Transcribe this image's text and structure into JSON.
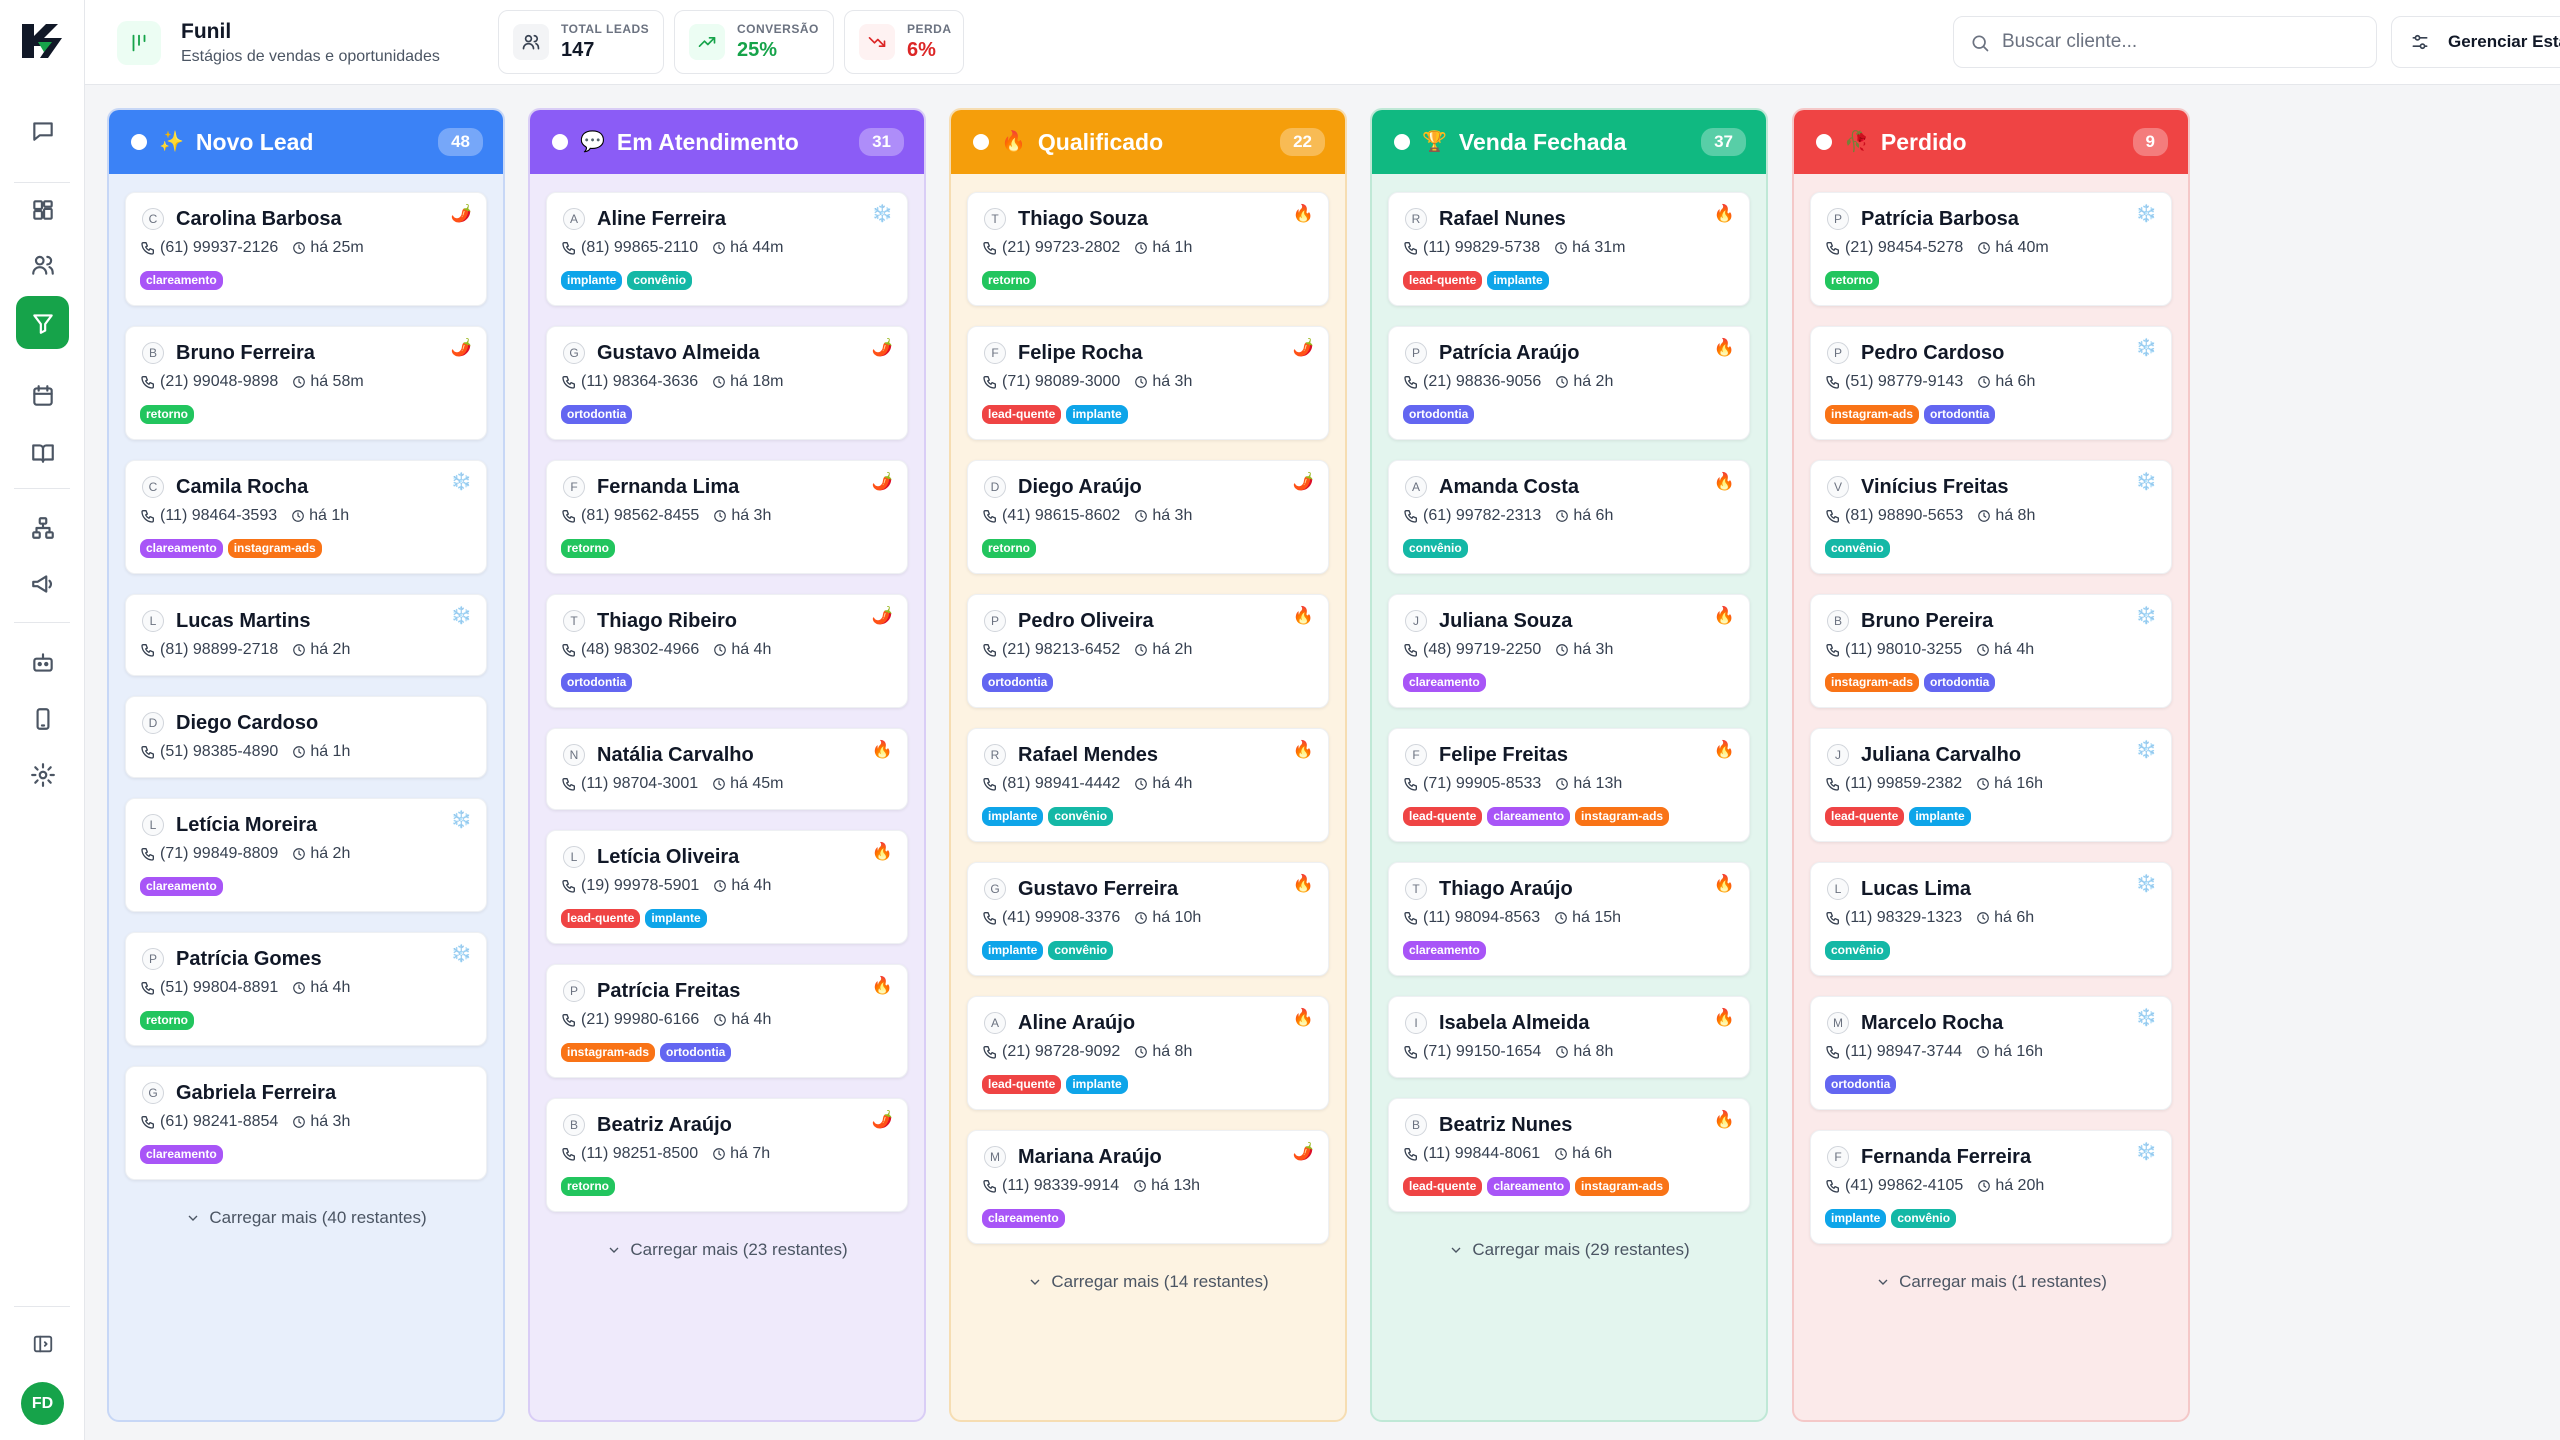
{
  "sidebar": {
    "logo_alt": "logo",
    "items": [
      {
        "icon": "chat-icon",
        "name": "chat"
      },
      {
        "icon": "dashboard-icon",
        "name": "dashboard"
      },
      {
        "icon": "users-icon",
        "name": "contacts"
      },
      {
        "icon": "funnel-icon",
        "name": "funnel",
        "active": true
      },
      {
        "icon": "calendar-icon",
        "name": "calendar"
      },
      {
        "icon": "book-icon",
        "name": "knowledge"
      },
      {
        "icon": "network-icon",
        "name": "integrations"
      },
      {
        "icon": "megaphone-icon",
        "name": "campaigns"
      },
      {
        "icon": "bot-icon",
        "name": "bot"
      },
      {
        "icon": "phone-icon",
        "name": "devices"
      },
      {
        "icon": "gear-icon",
        "name": "settings"
      }
    ],
    "avatar": "FD"
  },
  "header": {
    "title": "Funil",
    "subtitle": "Estágios de vendas e oportunidades",
    "stats": [
      {
        "label": "TOTAL LEADS",
        "value": "147",
        "color": "#111827",
        "icon": "users-icon"
      },
      {
        "label": "CONVERSÃO",
        "value": "25%",
        "color": "#16a34a",
        "icon": "trending-up-icon"
      },
      {
        "label": "PERDA",
        "value": "6%",
        "color": "#dc2626",
        "icon": "trending-down-icon"
      }
    ],
    "search_placeholder": "Buscar cliente...",
    "manage_label": "Gerenciar Estágios"
  },
  "tag_colors": {
    "clareamento": "#a855f7",
    "instagram-ads": "#f97316",
    "retorno": "#22c55e",
    "implante": "#0ea5e9",
    "convênio": "#14b8a6",
    "ortodontia": "#6366f1",
    "lead-quente": "#ef4444"
  },
  "columns": [
    {
      "title": "Novo Lead",
      "emoji": "✨",
      "count": "48",
      "color": "#3b82f6",
      "bg": "#e8effb",
      "border": "#c7d7f6",
      "more": "Carregar mais (40 restantes)",
      "cards": [
        {
          "initial": "C",
          "name": "Carolina Barbosa",
          "temp": "🌶️",
          "phone": "(61) 99937-2126",
          "time": "há 25m",
          "tags": [
            "clareamento"
          ]
        },
        {
          "initial": "B",
          "name": "Bruno Ferreira",
          "temp": "🌶️",
          "phone": "(21) 99048-9898",
          "time": "há 58m",
          "tags": [
            "retorno"
          ]
        },
        {
          "initial": "C",
          "name": "Camila Rocha",
          "temp": "❄️",
          "phone": "(11) 98464-3593",
          "time": "há 1h",
          "tags": [
            "clareamento",
            "instagram-ads"
          ]
        },
        {
          "initial": "L",
          "name": "Lucas Martins",
          "temp": "❄️",
          "phone": "(81) 98899-2718",
          "time": "há 2h",
          "tags": []
        },
        {
          "initial": "D",
          "name": "Diego Cardoso",
          "temp": "",
          "phone": "(51) 98385-4890",
          "time": "há 1h",
          "tags": []
        },
        {
          "initial": "L",
          "name": "Letícia Moreira",
          "temp": "❄️",
          "phone": "(71) 99849-8809",
          "time": "há 2h",
          "tags": [
            "clareamento"
          ]
        },
        {
          "initial": "P",
          "name": "Patrícia Gomes",
          "temp": "❄️",
          "phone": "(51) 99804-8891",
          "time": "há 4h",
          "tags": [
            "retorno"
          ]
        },
        {
          "initial": "G",
          "name": "Gabriela Ferreira",
          "temp": "",
          "phone": "(61) 98241-8854",
          "time": "há 3h",
          "tags": [
            "clareamento"
          ]
        }
      ]
    },
    {
      "title": "Em Atendimento",
      "emoji": "💬",
      "count": "31",
      "color": "#8b5cf6",
      "bg": "#efeafb",
      "border": "#d9cdf6",
      "more": "Carregar mais (23 restantes)",
      "cards": [
        {
          "initial": "A",
          "name": "Aline Ferreira",
          "temp": "❄️",
          "phone": "(81) 99865-2110",
          "time": "há 44m",
          "tags": [
            "implante",
            "convênio"
          ]
        },
        {
          "initial": "G",
          "name": "Gustavo Almeida",
          "temp": "🌶️",
          "phone": "(11) 98364-3636",
          "time": "há 18m",
          "tags": [
            "ortodontia"
          ]
        },
        {
          "initial": "F",
          "name": "Fernanda Lima",
          "temp": "🌶️",
          "phone": "(81) 98562-8455",
          "time": "há 3h",
          "tags": [
            "retorno"
          ]
        },
        {
          "initial": "T",
          "name": "Thiago Ribeiro",
          "temp": "🌶️",
          "phone": "(48) 98302-4966",
          "time": "há 4h",
          "tags": [
            "ortodontia"
          ]
        },
        {
          "initial": "N",
          "name": "Natália Carvalho",
          "temp": "🔥",
          "phone": "(11) 98704-3001",
          "time": "há 45m",
          "tags": []
        },
        {
          "initial": "L",
          "name": "Letícia Oliveira",
          "temp": "🔥",
          "phone": "(19) 99978-5901",
          "time": "há 4h",
          "tags": [
            "lead-quente",
            "implante"
          ]
        },
        {
          "initial": "P",
          "name": "Patrícia Freitas",
          "temp": "🔥",
          "phone": "(21) 99980-6166",
          "time": "há 4h",
          "tags": [
            "instagram-ads",
            "ortodontia"
          ]
        },
        {
          "initial": "B",
          "name": "Beatriz Araújo",
          "temp": "🌶️",
          "phone": "(11) 98251-8500",
          "time": "há 7h",
          "tags": [
            "retorno"
          ]
        }
      ]
    },
    {
      "title": "Qualificado",
      "emoji": "🔥",
      "count": "22",
      "color": "#f59e0b",
      "bg": "#fdf3e2",
      "border": "#f6ddb2",
      "more": "Carregar mais (14 restantes)",
      "cards": [
        {
          "initial": "T",
          "name": "Thiago Souza",
          "temp": "🔥",
          "phone": "(21) 99723-2802",
          "time": "há 1h",
          "tags": [
            "retorno"
          ]
        },
        {
          "initial": "F",
          "name": "Felipe Rocha",
          "temp": "🌶️",
          "phone": "(71) 98089-3000",
          "time": "há 3h",
          "tags": [
            "lead-quente",
            "implante"
          ]
        },
        {
          "initial": "D",
          "name": "Diego Araújo",
          "temp": "🌶️",
          "phone": "(41) 98615-8602",
          "time": "há 3h",
          "tags": [
            "retorno"
          ]
        },
        {
          "initial": "P",
          "name": "Pedro Oliveira",
          "temp": "🔥",
          "phone": "(21) 98213-6452",
          "time": "há 2h",
          "tags": [
            "ortodontia"
          ]
        },
        {
          "initial": "R",
          "name": "Rafael Mendes",
          "temp": "🔥",
          "phone": "(81) 98941-4442",
          "time": "há 4h",
          "tags": [
            "implante",
            "convênio"
          ]
        },
        {
          "initial": "G",
          "name": "Gustavo Ferreira",
          "temp": "🔥",
          "phone": "(41) 99908-3376",
          "time": "há 10h",
          "tags": [
            "implante",
            "convênio"
          ]
        },
        {
          "initial": "A",
          "name": "Aline Araújo",
          "temp": "🔥",
          "phone": "(21) 98728-9092",
          "time": "há 8h",
          "tags": [
            "lead-quente",
            "implante"
          ]
        },
        {
          "initial": "M",
          "name": "Mariana Araújo",
          "temp": "🌶️",
          "phone": "(11) 98339-9914",
          "time": "há 13h",
          "tags": [
            "clareamento"
          ]
        }
      ]
    },
    {
      "title": "Venda Fechada",
      "emoji": "🏆",
      "count": "37",
      "color": "#10b981",
      "bg": "#e3f5ee",
      "border": "#bfe8d6",
      "more": "Carregar mais (29 restantes)",
      "cards": [
        {
          "initial": "R",
          "name": "Rafael Nunes",
          "temp": "🔥",
          "phone": "(11) 99829-5738",
          "time": "há 31m",
          "tags": [
            "lead-quente",
            "implante"
          ]
        },
        {
          "initial": "P",
          "name": "Patrícia Araújo",
          "temp": "🔥",
          "phone": "(21) 98836-9056",
          "time": "há 2h",
          "tags": [
            "ortodontia"
          ]
        },
        {
          "initial": "A",
          "name": "Amanda Costa",
          "temp": "🔥",
          "phone": "(61) 99782-2313",
          "time": "há 6h",
          "tags": [
            "convênio"
          ]
        },
        {
          "initial": "J",
          "name": "Juliana Souza",
          "temp": "🔥",
          "phone": "(48) 99719-2250",
          "time": "há 3h",
          "tags": [
            "clareamento"
          ]
        },
        {
          "initial": "F",
          "name": "Felipe Freitas",
          "temp": "🔥",
          "phone": "(71) 99905-8533",
          "time": "há 13h",
          "tags": [
            "lead-quente",
            "clareamento",
            "instagram-ads"
          ]
        },
        {
          "initial": "T",
          "name": "Thiago Araújo",
          "temp": "🔥",
          "phone": "(11) 98094-8563",
          "time": "há 15h",
          "tags": [
            "clareamento"
          ]
        },
        {
          "initial": "I",
          "name": "Isabela Almeida",
          "temp": "🔥",
          "phone": "(71) 99150-1654",
          "time": "há 8h",
          "tags": []
        },
        {
          "initial": "B",
          "name": "Beatriz Nunes",
          "temp": "🔥",
          "phone": "(11) 99844-8061",
          "time": "há 6h",
          "tags": [
            "lead-quente",
            "clareamento",
            "instagram-ads"
          ]
        }
      ]
    },
    {
      "title": "Perdido",
      "emoji": "🥀",
      "count": "9",
      "color": "#ef4444",
      "bg": "#fbeaea",
      "border": "#f4c8c8",
      "more": "Carregar mais (1 restantes)",
      "cards": [
        {
          "initial": "P",
          "name": "Patrícia Barbosa",
          "temp": "❄️",
          "phone": "(21) 98454-5278",
          "time": "há 40m",
          "tags": [
            "retorno"
          ]
        },
        {
          "initial": "P",
          "name": "Pedro Cardoso",
          "temp": "❄️",
          "phone": "(51) 98779-9143",
          "time": "há 6h",
          "tags": [
            "instagram-ads",
            "ortodontia"
          ]
        },
        {
          "initial": "V",
          "name": "Vinícius Freitas",
          "temp": "❄️",
          "phone": "(81) 98890-5653",
          "time": "há 8h",
          "tags": [
            "convênio"
          ]
        },
        {
          "initial": "B",
          "name": "Bruno Pereira",
          "temp": "❄️",
          "phone": "(11) 98010-3255",
          "time": "há 4h",
          "tags": [
            "instagram-ads",
            "ortodontia"
          ]
        },
        {
          "initial": "J",
          "name": "Juliana Carvalho",
          "temp": "❄️",
          "phone": "(11) 99859-2382",
          "time": "há 16h",
          "tags": [
            "lead-quente",
            "implante"
          ]
        },
        {
          "initial": "L",
          "name": "Lucas Lima",
          "temp": "❄️",
          "phone": "(11) 98329-1323",
          "time": "há 6h",
          "tags": [
            "convênio"
          ]
        },
        {
          "initial": "M",
          "name": "Marcelo Rocha",
          "temp": "❄️",
          "phone": "(11) 98947-3744",
          "time": "há 16h",
          "tags": [
            "ortodontia"
          ]
        },
        {
          "initial": "F",
          "name": "Fernanda Ferreira",
          "temp": "❄️",
          "phone": "(41) 99862-4105",
          "time": "há 20h",
          "tags": [
            "implante",
            "convênio"
          ]
        }
      ]
    }
  ]
}
